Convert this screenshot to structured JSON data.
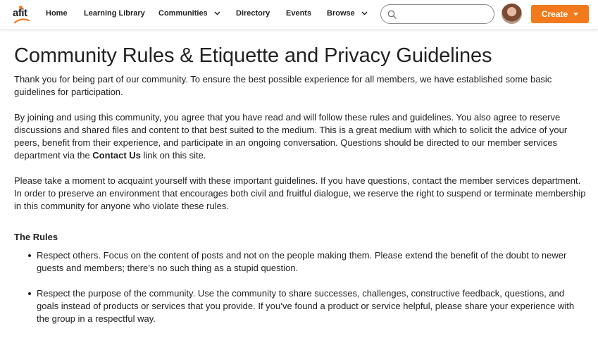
{
  "brand": {
    "logo_text": "afit",
    "accent_color": "#f27a1c"
  },
  "nav": {
    "items": [
      {
        "label": "Home",
        "has_dropdown": false
      },
      {
        "label": "Learning Library",
        "has_dropdown": false
      },
      {
        "label": "Communities",
        "has_dropdown": true
      },
      {
        "label": "Directory",
        "has_dropdown": false
      },
      {
        "label": "Events",
        "has_dropdown": false
      },
      {
        "label": "Browse",
        "has_dropdown": true
      }
    ]
  },
  "search": {
    "placeholder": "",
    "value": ""
  },
  "create_button": {
    "label": "Create"
  },
  "page": {
    "title": "Community Rules & Etiquette and Privacy Guidelines",
    "intro": "Thank you for being part of our community. To ensure the best possible experience for all members, we have established some basic guidelines for participation.",
    "para2_before": "By joining and using this community, you agree that you have read and will follow these rules and guidelines. You also agree to reserve discussions and shared files and content to that best suited to the medium. This is a great medium with which to solicit the advice of your peers, benefit from their experience, and participate in an ongoing conversation. Questions should be directed to our member services department via the ",
    "para2_link": "Contact Us",
    "para2_after": " link on this site.",
    "para3": "Please take a moment to acquaint yourself with these important guidelines. If you have questions, contact the member services department. In order to preserve an environment that encourages both civil and fruitful dialogue, we reserve the right to suspend or terminate membership in this community for anyone who violate these rules.",
    "rules_heading": "The Rules",
    "rules": [
      "Respect others. Focus on the content of posts and not on the people making them. Please extend the benefit of the doubt to newer guests and members; there’s no such thing as a stupid question.",
      "Respect the purpose of the community. Use the community to share successes, challenges, constructive feedback, questions, and goals instead of products or services that you provide. If you’ve found a product or service helpful, please share your experience with the group in a respectful way."
    ]
  }
}
